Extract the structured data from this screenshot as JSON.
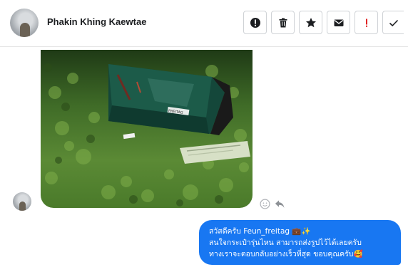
{
  "header": {
    "name": "Phakin Khing Kaewtae",
    "tools": [
      {
        "icon": "alert-circle-icon"
      },
      {
        "icon": "trash-icon"
      },
      {
        "icon": "star-icon"
      },
      {
        "icon": "envelope-icon"
      },
      {
        "icon": "exclamation-icon"
      },
      {
        "icon": "check-icon"
      }
    ]
  },
  "message_image": {
    "label": "FREITAG"
  },
  "message": {
    "line1": "สวัสดีครับ  Feun_freitag 💼✨",
    "line2": "สนใจกระเป๋ารุ่นไหน สามารถส่งรูปไว้ได้เลยครับ",
    "line3": "ทางเราจะตอบกลับอย่างเร็วที่สุด ขอบคุณครับ🥰"
  },
  "colors": {
    "bubble": "#1877f2",
    "exclamation": "#e02424"
  }
}
